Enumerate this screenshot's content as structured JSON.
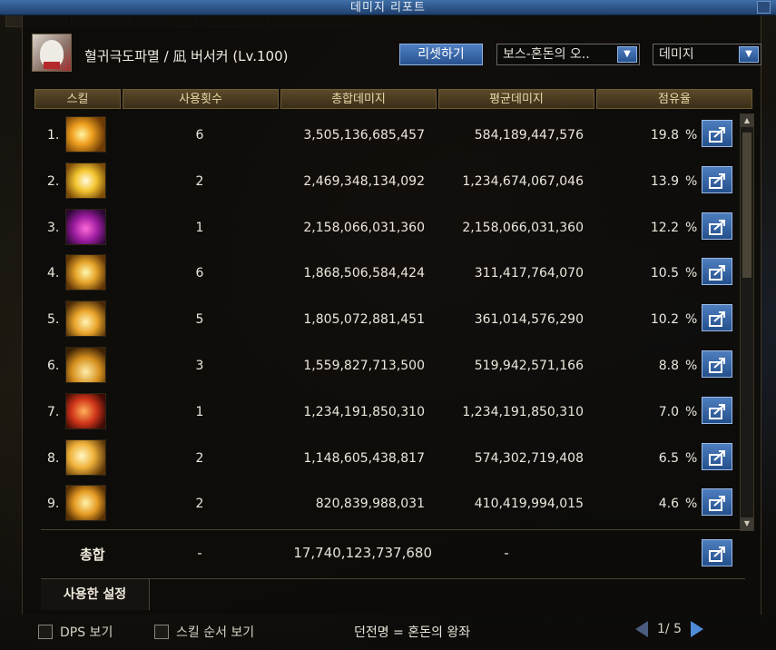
{
  "window": {
    "title": "데미지 리포트"
  },
  "header": {
    "character": "혈귀극도파멸 / 凪 버서커 (Lv.100)",
    "reset_label": "리셋하기",
    "target_select": "보스-혼돈의 오..",
    "metric_select": "데미지"
  },
  "table": {
    "columns": [
      "스킬",
      "사용횟수",
      "총합데미지",
      "평균데미지",
      "점유율"
    ],
    "rows": [
      {
        "rank": "1.",
        "icon": "slash-burst-icon",
        "uses": "6",
        "total": "3,505,136,685,457",
        "avg": "584,189,447,576",
        "pct": "19.8",
        "pct_unit": "%"
      },
      {
        "rank": "2.",
        "icon": "explosion-icon",
        "uses": "2",
        "total": "2,469,348,134,092",
        "avg": "1,234,674,067,046",
        "pct": "13.9",
        "pct_unit": "%"
      },
      {
        "rank": "3.",
        "icon": "demon-mask-icon",
        "uses": "1",
        "total": "2,158,066,031,360",
        "avg": "2,158,066,031,360",
        "pct": "12.2",
        "pct_unit": "%"
      },
      {
        "rank": "4.",
        "icon": "blood-fortress-icon",
        "uses": "6",
        "total": "1,868,506,584,424",
        "avg": "311,417,764,070",
        "pct": "10.5",
        "pct_unit": "%"
      },
      {
        "rank": "5.",
        "icon": "flame-burst-icon",
        "uses": "5",
        "total": "1,805,072,881,451",
        "avg": "361,014,576,290",
        "pct": "10.2",
        "pct_unit": "%"
      },
      {
        "rank": "6.",
        "icon": "ground-eruption-icon",
        "uses": "3",
        "total": "1,559,827,713,500",
        "avg": "519,942,571,166",
        "pct": "8.8",
        "pct_unit": "%"
      },
      {
        "rank": "7.",
        "icon": "rage-beast-icon",
        "uses": "1",
        "total": "1,234,191,850,310",
        "avg": "1,234,191,850,310",
        "pct": "7.0",
        "pct_unit": "%"
      },
      {
        "rank": "8.",
        "icon": "claw-slash-icon",
        "uses": "2",
        "total": "1,148,605,438,817",
        "avg": "574,302,719,408",
        "pct": "6.5",
        "pct_unit": "%"
      },
      {
        "rank": "9.",
        "icon": "whirlwind-icon",
        "uses": "2",
        "total": "820,839,988,031",
        "avg": "410,419,994,015",
        "pct": "4.6",
        "pct_unit": "%"
      }
    ],
    "summary": {
      "label": "총합",
      "uses": "-",
      "total": "17,740,123,737,680",
      "avg": "-"
    }
  },
  "settings": {
    "tab_label": "사용한 설정"
  },
  "footer": {
    "dps_label": "DPS 보기",
    "skill_order_label": "스킬 순서 보기",
    "dungeon": "던전명 = 혼돈의 왕좌",
    "page": "1/ 5"
  },
  "colors": {
    "accent_blue": "#3f6fa8",
    "header_gold": "#e8d7a8"
  }
}
